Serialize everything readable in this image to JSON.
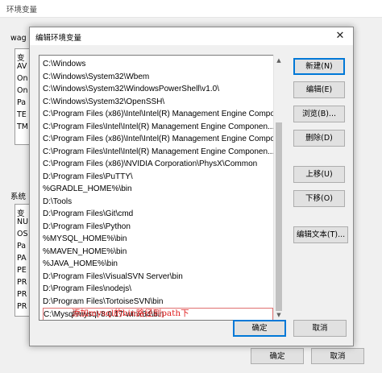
{
  "background_window": {
    "title": "环境变量",
    "user_section_label": "wag",
    "user_header": "变",
    "user_rows": [
      "AV",
      "On",
      "On",
      "Pa",
      "TE",
      "TM"
    ],
    "system_section_label": "系统",
    "system_header": "变",
    "system_rows": [
      "NU",
      "OS",
      "Pa",
      "PA",
      "PE",
      "PR",
      "PR",
      "PR"
    ],
    "ok_label": "确定",
    "cancel_label": "取消"
  },
  "dialog": {
    "title": "编辑环境变量",
    "close_label": "✕",
    "path_entries": [
      "C:\\Windows",
      "C:\\Windows\\System32\\Wbem",
      "C:\\Windows\\System32\\WindowsPowerShell\\v1.0\\",
      "C:\\Windows\\System32\\OpenSSH\\",
      "C:\\Program Files (x86)\\Intel\\Intel(R) Management Engine Compo...",
      "C:\\Program Files\\Intel\\Intel(R) Management Engine Componen...",
      "C:\\Program Files (x86)\\Intel\\Intel(R) Management Engine Compo...",
      "C:\\Program Files\\Intel\\Intel(R) Management Engine Componen...",
      "C:\\Program Files (x86)\\NVIDIA Corporation\\PhysX\\Common",
      "D:\\Program Files\\PuTTY\\",
      "%GRADLE_HOME%\\bin",
      "D:\\Tools",
      "D:\\Program Files\\Git\\cmd",
      "D:\\Program Files\\Python",
      "%MYSQL_HOME%\\bin",
      "%MAVEN_HOME%\\bin",
      "%JAVA_HOME%\\bin",
      "D:\\Program Files\\VisualSVN Server\\bin",
      "D:\\Program Files\\nodejs\\",
      "D:\\Program Files\\TortoiseSVN\\bin",
      "C:\\Mysql\\mysql-8.0.17-winx64\\bin"
    ],
    "selected_index": 20,
    "buttons": {
      "new": "新建(N)",
      "edit": "编辑(E)",
      "browse": "浏览(B)...",
      "delete": "删除(D)",
      "move_up": "上移(U)",
      "move_down": "下移(O)",
      "edit_text": "编辑文本(T)...",
      "ok": "确定",
      "cancel": "取消"
    },
    "annotation": "添加mysql的bin路径到path下"
  },
  "colors": {
    "selection_border": "#e07070",
    "annotation": "#e02020",
    "primary_border": "#0078d7"
  }
}
